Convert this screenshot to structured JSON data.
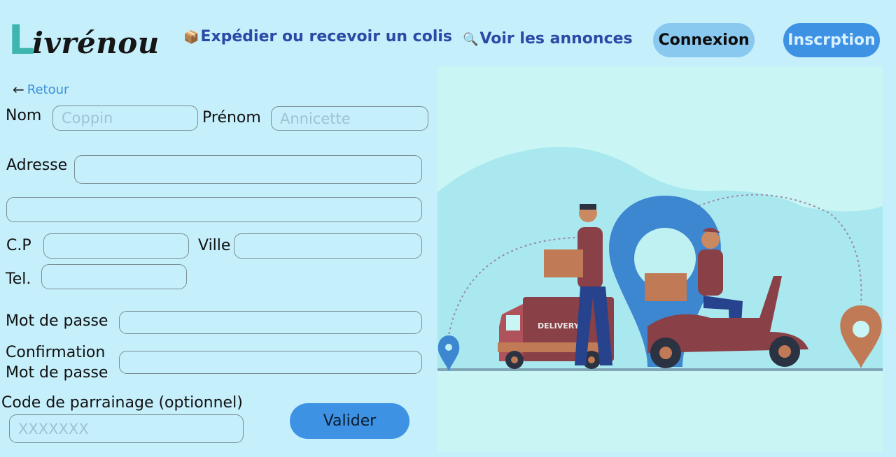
{
  "header": {
    "logo_first": "L",
    "logo_rest": "ivrénou",
    "nav": [
      {
        "icon": "package-emoji-icon",
        "glyph": "📦",
        "label": "Expédier ou recevoir un colis"
      },
      {
        "icon": "magnifier-emoji-icon",
        "glyph": "🔍",
        "label": "Voir les annonces"
      }
    ],
    "login_label": "Connexion",
    "signup_label": "Inscrption"
  },
  "back": {
    "label": "Retour",
    "icon": "arrow-left-icon"
  },
  "form": {
    "nom_label": "Nom",
    "nom_placeholder": "Coppin",
    "prenom_label": "Prénom",
    "prenom_placeholder": "Annicette",
    "adresse_label": "Adresse",
    "cp_label": "C.P",
    "ville_label": "Ville",
    "tel_label": "Tel.",
    "password_label": "Mot de passe",
    "confirm_label_line1": "Confirmation",
    "confirm_label_line2": "Mot de passe",
    "referral_label": "Code de parrainage (optionnel)",
    "referral_placeholder": "XXXXXXX",
    "submit_label": "Valider"
  },
  "illustration": {
    "van_text": "DELIVERY"
  },
  "colors": {
    "background": "#c5effb",
    "nav_link": "#2b4aa6",
    "primary_button": "#3e92e4",
    "secondary_button": "#89c9ef",
    "logo_accent": "#3fb5b0"
  }
}
